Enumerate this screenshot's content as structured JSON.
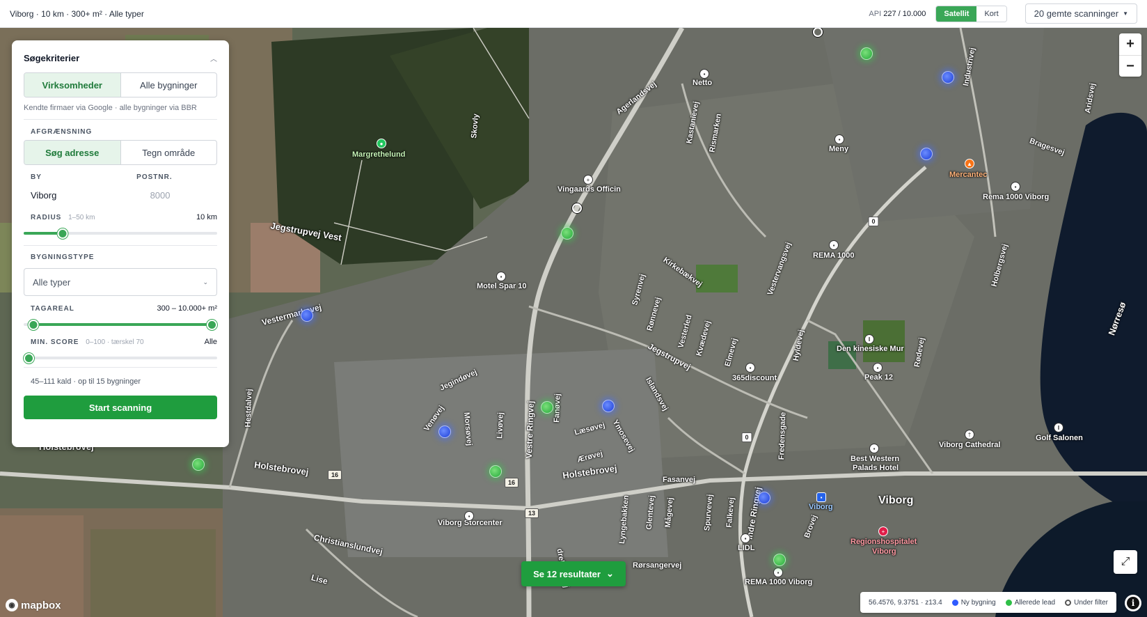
{
  "topbar": {
    "summary": "Viborg · 10 km · 300+ m² · Alle typer",
    "api_label": "API",
    "api_value": "227 / 10.000",
    "map_styles": [
      "Satellit",
      "Kort"
    ],
    "saved_scans": "20 gemte scanninger"
  },
  "panel": {
    "title": "Søgekriterier",
    "mode_tabs": [
      "Virksomheder",
      "Alle bygninger"
    ],
    "mode_hint": "Kendte firmaer via Google · alle bygninger via BBR",
    "limit_label": "AFGRÆNSNING",
    "limit_tabs": [
      "Søg adresse",
      "Tegn område"
    ],
    "city_label": "BY",
    "city_value": "Viborg",
    "zip_label": "POSTNR.",
    "zip_placeholder": "8000",
    "radius_label": "RADIUS",
    "radius_range": "1–50 km",
    "radius_value": "10 km",
    "radius_fraction": 0.2,
    "building_type_label": "BYGNINGSTYPE",
    "building_type_value": "Alle typer",
    "roof_label": "TAGAREAL",
    "roof_value": "300 – 10.000+ m²",
    "roof_min_fraction": 0.05,
    "roof_max_fraction": 1.0,
    "score_label": "MIN. SCORE",
    "score_range": "0–100 · tærskel 70",
    "score_value": "Alle",
    "score_fraction": 0.0,
    "cost_hint": "45–111 kald · op til 15 bygninger",
    "start_button": "Start scanning"
  },
  "map": {
    "results_button": "Se 12 resultater",
    "labels": {
      "margrethelund": "Margrethelund",
      "skovly": "Skovly",
      "netto": "Netto",
      "agerlandsvej": "Agerlandsvej",
      "kastanievej": "Kastanievej",
      "rismarken": "Rismarken",
      "meny": "Meny",
      "mercantec": "Mercantec",
      "industrivej": "Industrivej",
      "aridsvej": "Aridsvej",
      "bragesvej": "Bragesvej",
      "rema_viborg": "Rema 1000 Viborg",
      "vingaards": "Vingaards Officin",
      "jegstrupvej_vest": "Jegstrupvej Vest",
      "motel_spar": "Motel Spar 10",
      "kirkebaekvej": "Kirkebækvej",
      "rema_1000": "REMA 1000",
      "vestervangsvej": "Vestervangsvej",
      "holbergsvej": "Holbergsvej",
      "norreso": "Nørresø",
      "vestermarksvej": "Vestermarksvej",
      "syrenvej": "Syrenvej",
      "ronnevej": "Rønnevej",
      "vesterled": "Vesterled",
      "kvaedevej": "Kvædevej",
      "jegstrupvej": "Jegstrupvej",
      "elmevej": "Elmevej",
      "hyldevej": "Hyldevej",
      "kinesiske": "Den kinesiske Mur",
      "rodevej": "Rødevej",
      "peak12": "Peak 12",
      "discount365": "365discount",
      "islandsvej": "Islandsvej",
      "jegindovej": "Jegindøvej",
      "hestdalvej": "Hestdalvej",
      "venovej": "Venøvej",
      "morsovej": "Morsøvej",
      "livovej": "Livøvej",
      "vestre_ringvej": "Vestre Ringvej",
      "fanovej": "Fanøvej",
      "laesovej": "Læsøvej",
      "amosevej": "Ymosevej",
      "aerovej": "Ærøvej",
      "fredensgade": "Fredensgade",
      "holstebrovej_w": "Holstebrovej",
      "holstebrovej_m": "Holstebrovej",
      "holstebrovej_e": "Holstebrovej",
      "fasanvej": "Fasanvej",
      "best_western": "Best Western",
      "palads_hotel": "Palads Hotel",
      "viborg_cathedral": "Viborg Cathedral",
      "golf_salonen": "Golf Salonen",
      "viborg_storcenter": "Viborg Storcenter",
      "christianslundvej": "Christianslundvej",
      "viborg_big": "Viborg",
      "viborg_station": "Viborg",
      "lidl": "LIDL",
      "region_1": "Regionshospitalet",
      "region_2": "Viborg",
      "indre_ringvej": "Indre Ringvej",
      "falkevej": "Falkevej",
      "spurvevej": "Spurvevej",
      "magevej": "Mågevej",
      "glentevej": "Glentevej",
      "lyngebakken": "Lyngebakken",
      "brovej": "Brovej",
      "rorsangervej": "Rørsangervej",
      "rema_viborg_2": "REMA 1000 Viborg",
      "lise": "Lise",
      "dreringvej": "dreRingvej"
    },
    "shields": [
      "0",
      "0",
      "16",
      "16",
      "13"
    ],
    "coords": "56.4576, 9.3751 · z13.4",
    "legend": [
      "Ny bygning",
      "Allerede lead",
      "Under filter"
    ],
    "attribution": "mapbox",
    "colors": {
      "new_building": "#2f5bff",
      "existing_lead": "#2fbf47",
      "under_filter": "#9ca3af",
      "accent": "#1f9d3e"
    }
  }
}
